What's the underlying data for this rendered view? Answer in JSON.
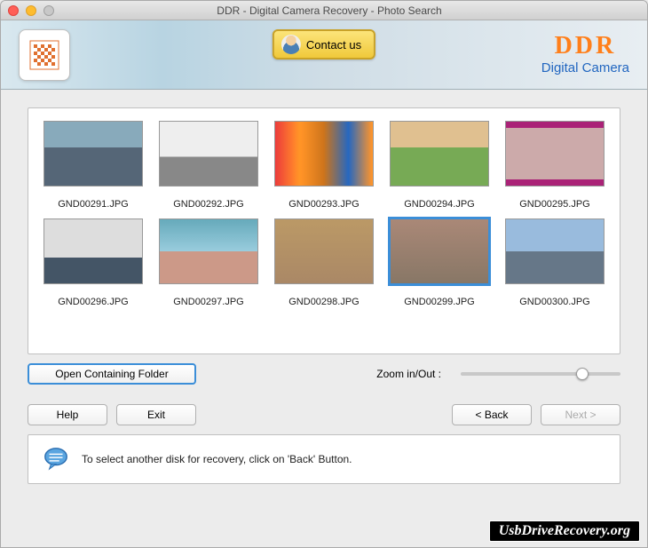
{
  "window": {
    "title": "DDR - Digital Camera Recovery - Photo Search"
  },
  "header": {
    "contact_label": "Contact us",
    "brand_main": "DDR",
    "brand_sub": "Digital Camera"
  },
  "thumbnails": [
    {
      "filename": "GND00291.JPG",
      "selected": false,
      "style": "p1"
    },
    {
      "filename": "GND00292.JPG",
      "selected": false,
      "style": "p2"
    },
    {
      "filename": "GND00293.JPG",
      "selected": false,
      "style": "p3"
    },
    {
      "filename": "GND00294.JPG",
      "selected": false,
      "style": "p4"
    },
    {
      "filename": "GND00295.JPG",
      "selected": false,
      "style": "p5"
    },
    {
      "filename": "GND00296.JPG",
      "selected": false,
      "style": "p6"
    },
    {
      "filename": "GND00297.JPG",
      "selected": false,
      "style": "p7"
    },
    {
      "filename": "GND00298.JPG",
      "selected": false,
      "style": "p8"
    },
    {
      "filename": "GND00299.JPG",
      "selected": true,
      "style": "p9"
    },
    {
      "filename": "GND00300.JPG",
      "selected": false,
      "style": "p10"
    }
  ],
  "controls": {
    "open_folder_label": "Open Containing Folder",
    "zoom_label": "Zoom in/Out :",
    "zoom_value": 72
  },
  "nav": {
    "help_label": "Help",
    "exit_label": "Exit",
    "back_label": "< Back",
    "next_label": "Next >",
    "next_enabled": false
  },
  "info": {
    "message": "To select another disk for recovery, click on 'Back' Button."
  },
  "watermark": "UsbDriveRecovery.org"
}
